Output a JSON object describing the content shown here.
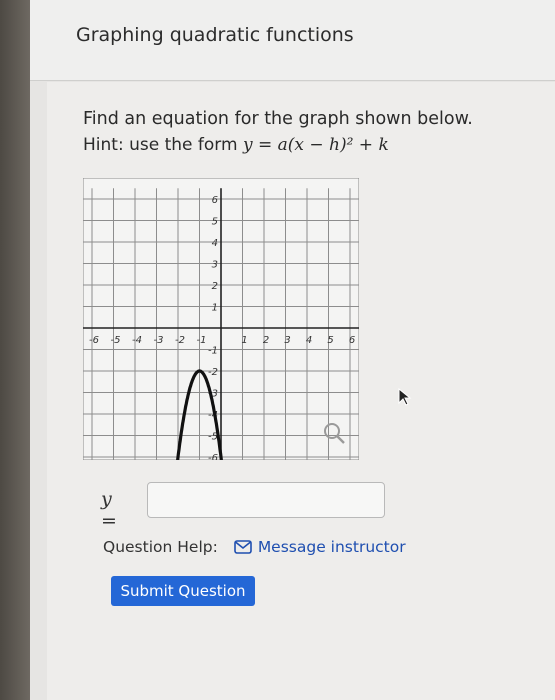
{
  "header": {
    "title": "Graphing quadratic functions"
  },
  "question": {
    "prompt": "Find an equation for the graph shown below.",
    "hint_label": "Hint:",
    "hint_text": "use the form",
    "hint_formula": "y = a(x − h)² + k"
  },
  "chart_data": {
    "type": "line",
    "xlim": [
      -6,
      6
    ],
    "ylim": [
      -6,
      6
    ],
    "grid": true,
    "x_ticks": [
      "-6",
      "-5",
      "-4",
      "-3",
      "-2",
      "-1",
      "1",
      "2",
      "3",
      "4",
      "5",
      "6"
    ],
    "y_ticks": [
      "6",
      "5",
      "4",
      "3",
      "2",
      "1",
      "-1",
      "-2",
      "-3",
      "-4",
      "-5",
      "-6"
    ],
    "series": [
      {
        "vertex": [
          -1,
          -2
        ],
        "a": -4,
        "x": [
          -2.22,
          -2,
          -1.5,
          -1,
          -0.5,
          0,
          0.22
        ],
        "y": [
          -8,
          -6,
          -3,
          -2,
          -3,
          -6,
          -8
        ]
      }
    ]
  },
  "answer": {
    "label": "y =",
    "value": ""
  },
  "help": {
    "label": "Question Help:",
    "message_link": "Message instructor"
  },
  "submit": {
    "label": "Submit Question"
  },
  "icons": {
    "magnify": "magnifier-icon",
    "mail": "envelope-icon"
  }
}
